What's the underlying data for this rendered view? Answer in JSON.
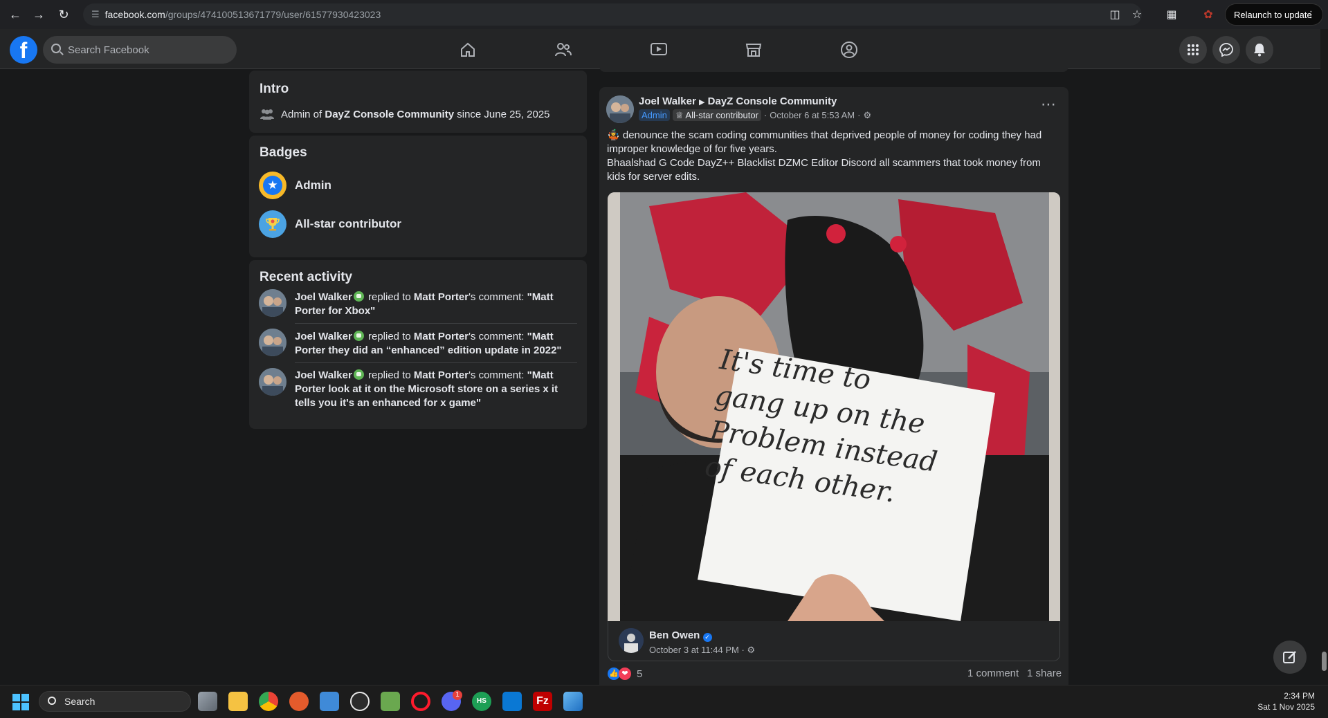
{
  "browser": {
    "url_host": "facebook.com",
    "url_path": "/groups/474100513671779/user/61577930423023",
    "relaunch_label": "Relaunch to update"
  },
  "fb": {
    "search_placeholder": "Search Facebook"
  },
  "intro": {
    "title": "Intro",
    "text_prefix": "Admin of ",
    "group": "DayZ Console Community",
    "text_suffix": " since June 25, 2025"
  },
  "badges": {
    "title": "Badges",
    "items": [
      {
        "label": "Admin"
      },
      {
        "label": "All-star contributor"
      }
    ]
  },
  "recent_activity": {
    "title": "Recent activity",
    "items": [
      {
        "user": "Joel Walker",
        "action": " replied to ",
        "target": "Matt Porter",
        "possessive": "'s comment: ",
        "quote": "\"Matt Porter for Xbox\""
      },
      {
        "user": "Joel Walker",
        "action": " replied to ",
        "target": "Matt Porter",
        "possessive": "'s comment: ",
        "quote": "\"Matt Porter they did an “enhanced” edition update in 2022\""
      },
      {
        "user": "Joel Walker",
        "action": " replied to ",
        "target": "Matt Porter",
        "possessive": "'s comment: ",
        "quote": "\"Matt Porter look at it on the Microsoft store on a series x it tells you it's an enhanced for x game\""
      }
    ]
  },
  "post": {
    "author": "Joel Walker",
    "group": "DayZ Console Community",
    "role_tag": "Admin",
    "contrib_tag": "All-star contributor",
    "timestamp": "October 6 at 5:53 AM",
    "dot": "·",
    "body_line1": "denounce the scam coding communities that deprived people of money for coding they had improper knowledge of for five years.",
    "body_line2": "Bhaalshad G Code DayZ++ Blacklist DZMC Editor Discord all scammers that took money from kids for server edits.",
    "sign_text": [
      "It's time to",
      "gang up on the",
      "Problem instead",
      "of each other."
    ],
    "shared_author": "Ben Owen",
    "shared_time": "October 3 at 11:44 PM",
    "reaction_count": "5",
    "comments": "1 comment",
    "shares": "1 share"
  },
  "taskbar": {
    "search_label": "Search",
    "time": "2:34 PM",
    "date": "Sat 1 Nov 2025",
    "discord_badge": "1"
  },
  "colors": {
    "fb_blue": "#1877f2",
    "bg": "#18191a",
    "card": "#242526",
    "admin_tag_bg": "#263951"
  }
}
